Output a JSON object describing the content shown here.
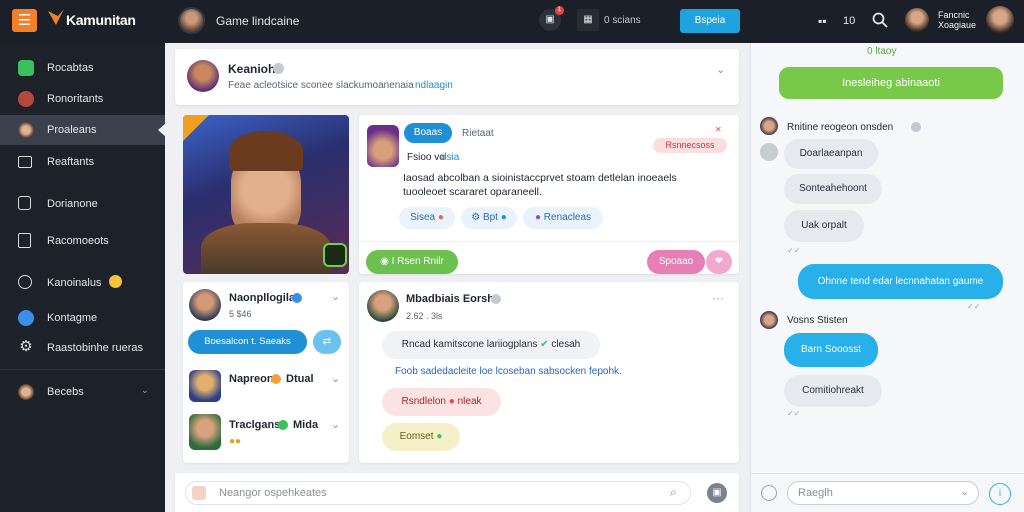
{
  "app": {
    "logo_text": "Kamunitan",
    "menu_icon": "hamburger-icon"
  },
  "topbar": {
    "title": "Game lindcaine",
    "notification_badge": "1",
    "status_text": "0 scians",
    "cta_label": "Bspeia",
    "count": "10",
    "user_name": "Fancnic Xoagiaue"
  },
  "sidebar": {
    "items": [
      {
        "label": "Rocabtas",
        "color": "#3cc05a"
      },
      {
        "label": "Ronoritants",
        "color": "#c04a3e"
      },
      {
        "label": "Proaleans",
        "color": "#b98469"
      },
      {
        "label": "Reaftants",
        "color": "#e0e3e8"
      },
      {
        "label": "Dorianone",
        "color": "#e0e3e8"
      },
      {
        "label": "Racomoeots",
        "color": "#e0e3e8"
      },
      {
        "label": "Kanoinalus",
        "color": "#e0e3e8"
      },
      {
        "label": "Kontagme",
        "color": "#3a8fe8"
      },
      {
        "label": "Raastobinhe rueras",
        "color": "#e0e3e8"
      },
      {
        "label": "Becebs",
        "color": "#b98469"
      }
    ]
  },
  "compose": {
    "name": "Keanioh",
    "subtitle": "Feae acleotsice sconee slackumoanenaia",
    "link": "ndlaagin"
  },
  "featured": {
    "tag": "Boaas",
    "meta": "Rietaat",
    "label_badge": "Rsnnecsoss",
    "line1": "Fsioo vo",
    "line1_link": "dsia",
    "body": "Iaosad abcolban a sioinistaccprvet stoam detlelan inoeaels tuooleoet scararet oparaneell.",
    "chips": [
      "Sisea",
      "Bpt",
      "Renacleas"
    ],
    "action_label": "I Rsen Rnilr",
    "action_right": "Spoaao"
  },
  "friends": [
    {
      "name": "Naonpllogila",
      "sub": "5 $46",
      "button": "Boesalcon t. Saeaks"
    },
    {
      "name": "Napreon",
      "sub": "Dtual"
    },
    {
      "name": "Traclgans",
      "sub": "Mida"
    }
  ],
  "post": {
    "author": "Mbadbiais Eorsh",
    "meta": "2.62 . 3ls",
    "bubbles": [
      "Rncad kamitscone lariiogplans",
      "Foob sadedacleite loe lcoseban sabsocken fepohk.",
      "Rsndlelon",
      "Eomset"
    ],
    "bubble1_suffix": "clesah",
    "bubble3_suffix": "nleak"
  },
  "reply": {
    "placeholder": "Neangor ospehkeates"
  },
  "chat": {
    "header_status": "0 ltaoy",
    "banner": "Inesleiheg abinaaoti",
    "group1_name": "Rnitine reogeon onsden",
    "messages_left1": [
      "Doarlaeanpan",
      "Sonteahehoont",
      "Uak orpalt"
    ],
    "message_right1": "Ohnne tend edar lecnnahatan gaume",
    "group2_name": "Vosns Stisten",
    "message_right2": "Barn Sooosst",
    "message_left2": "Comitiohreakt",
    "input_placeholder": "Raeglh"
  }
}
